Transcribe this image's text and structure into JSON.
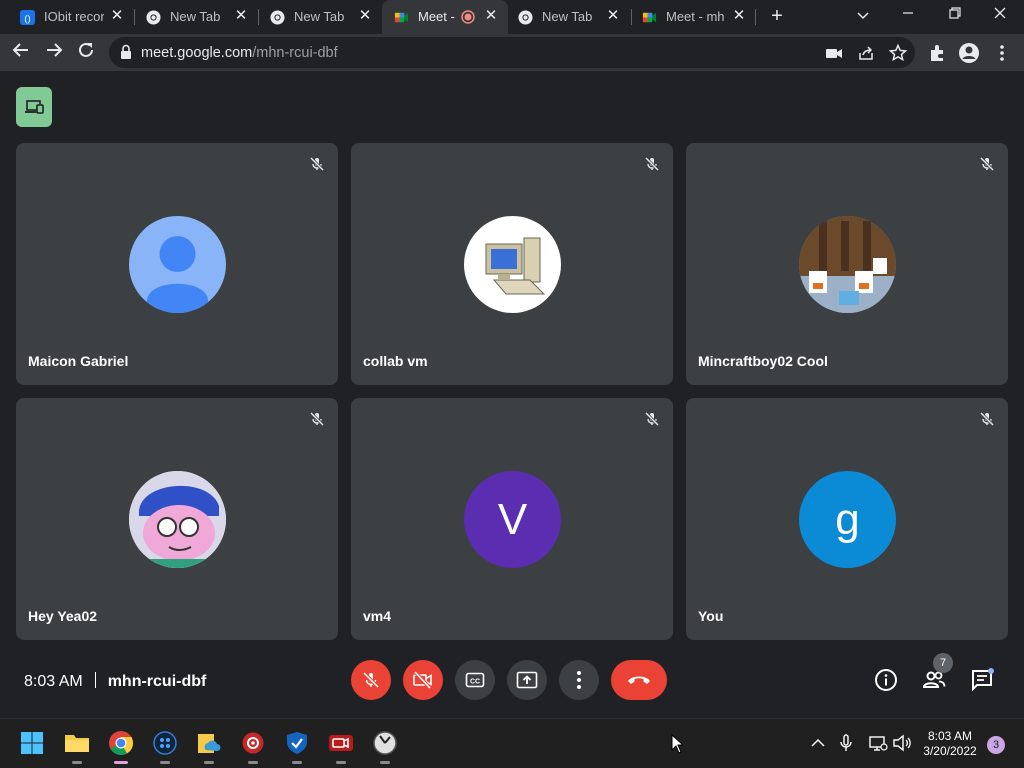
{
  "browser": {
    "tabs": [
      {
        "title": "IObit recor",
        "icon": "iobit-icon"
      },
      {
        "title": "New Tab",
        "icon": "chrome-icon"
      },
      {
        "title": "New Tab",
        "icon": "chrome-icon"
      },
      {
        "title": "Meet -",
        "icon": "meet-icon",
        "active": true,
        "recording": true
      },
      {
        "title": "New Tab",
        "icon": "chrome-icon"
      },
      {
        "title": "Meet - mh",
        "icon": "meet-icon"
      }
    ],
    "url_host": "meet.google.com",
    "url_path": "/mhn-rcui-dbf"
  },
  "meet": {
    "participants": [
      {
        "name": "Maicon Gabriel",
        "avatar": "default-person-avatar"
      },
      {
        "name": "collab vm",
        "avatar": "computer-avatar"
      },
      {
        "name": "Mincraftboy02 Cool",
        "avatar": "minecraft-avatar"
      },
      {
        "name": "Hey Yea02",
        "avatar": "cartoon-avatar"
      },
      {
        "name": "vm4",
        "avatar": "initial-avatar",
        "initial": "V",
        "color": "#5b2db0"
      },
      {
        "name": "You",
        "avatar": "initial-avatar",
        "initial": "g",
        "color": "#0b8ad6"
      }
    ],
    "time": "8:03 AM",
    "meeting_code": "mhn-rcui-dbf",
    "people_count": "7"
  },
  "taskbar": {
    "time": "8:03 AM",
    "date": "3/20/2022",
    "notifications": "3"
  },
  "colors": {
    "red": "#ea4335",
    "tile": "#3c4043",
    "bg": "#202124",
    "companion": "#81c995"
  }
}
